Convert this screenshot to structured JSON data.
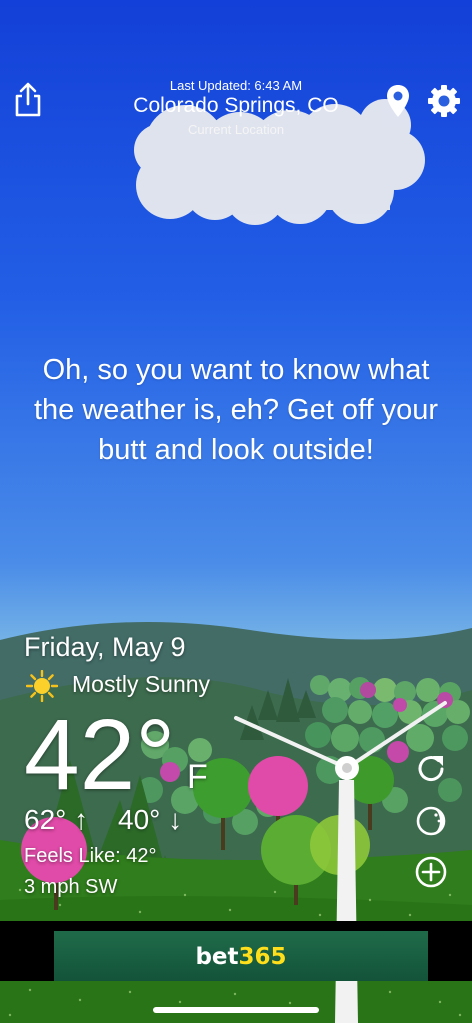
{
  "header": {
    "last_updated": "Last Updated: 6:43 AM",
    "location_name": "Colorado Springs, CO",
    "location_sub": "Current Location"
  },
  "icons": {
    "share": "share-icon",
    "location": "location-pin-icon",
    "settings": "gear-icon",
    "refresh": "refresh-icon",
    "moon": "moon-icon",
    "add": "plus-circle-icon",
    "sun": "sun-icon"
  },
  "message": "Oh, so you want to know what the weather is, eh? Get off your butt and look outside!",
  "weather": {
    "date": "Friday, May 9",
    "condition": "Mostly Sunny",
    "temperature": "42°",
    "unit": "F",
    "high": "62°",
    "low": "40°",
    "feels_like": "Feels Like: 42°",
    "wind": "3 mph SW"
  },
  "ad": {
    "brand_part1": "bet",
    "brand_part2": "365",
    "brand_color1": "#ffffff",
    "brand_color2": "#ffdf1b"
  },
  "colors": {
    "sky_top": "#1340d8",
    "grass": "#2e7d1c",
    "ad_bg": "#1a6142"
  }
}
